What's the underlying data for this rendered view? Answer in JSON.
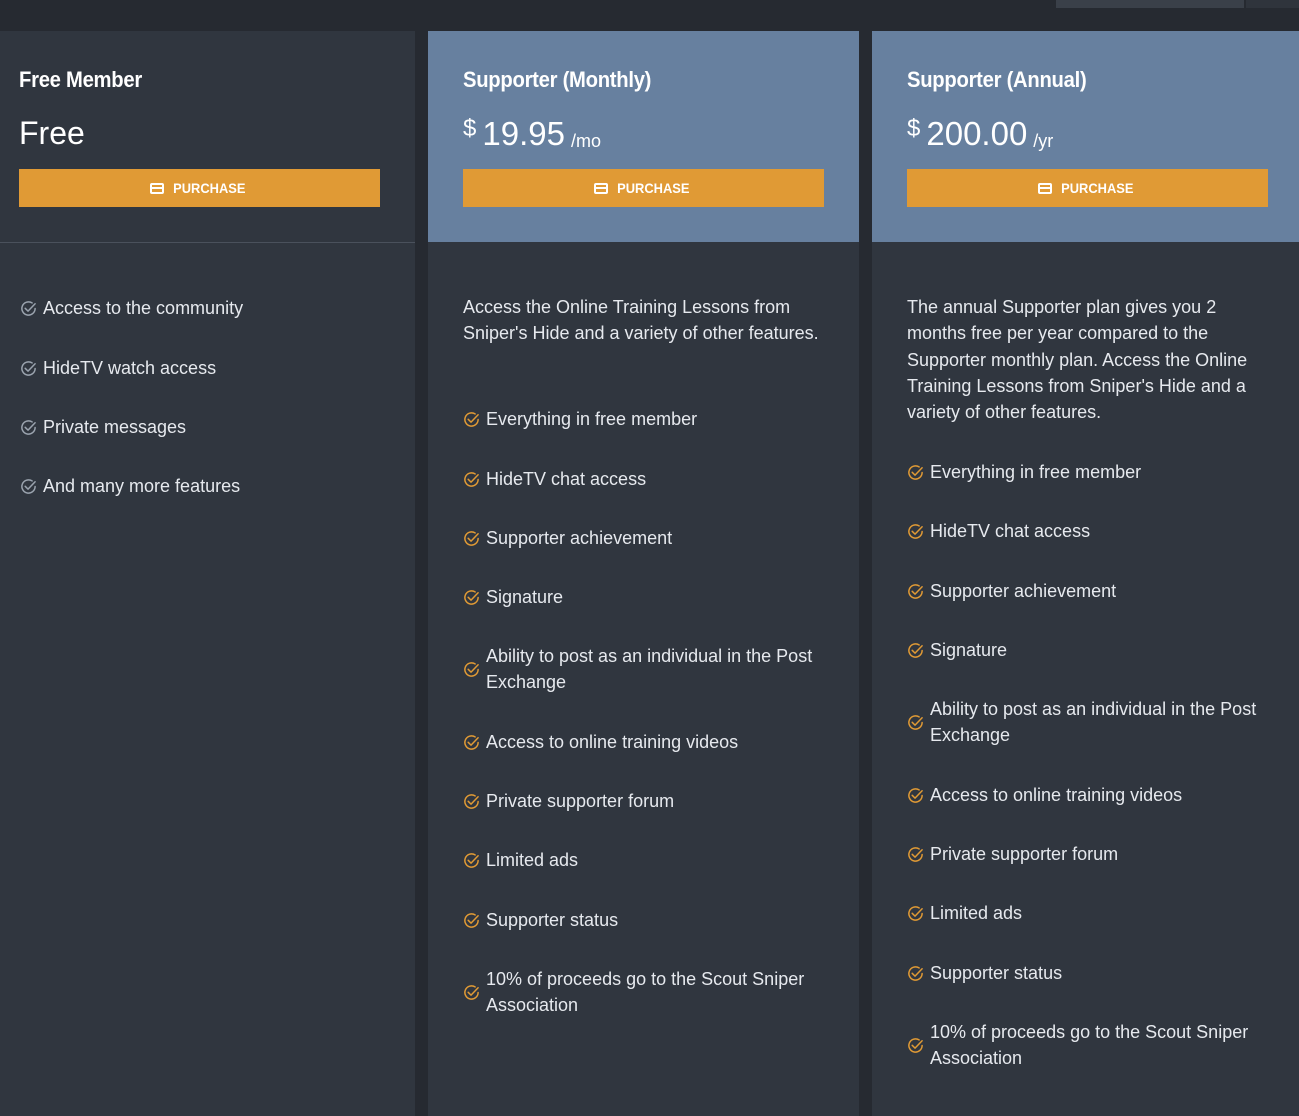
{
  "plans": [
    {
      "title": "Free Member",
      "price_text": "Free",
      "button_label": "PURCHASE",
      "features": [
        "Access to the community",
        "HideTV watch access",
        "Private messages",
        "And many more features"
      ]
    },
    {
      "title": "Supporter (Monthly)",
      "currency": "$",
      "amount": "19.95",
      "period": "/mo",
      "button_label": "PURCHASE",
      "description": "Access the Online Training Lessons from Sniper's Hide and a variety of other features.",
      "features": [
        "Everything in free member",
        "HideTV chat access",
        "Supporter achievement",
        "Signature",
        "Ability to post as an individual in the Post Exchange",
        "Access to online training videos",
        "Private supporter forum",
        "Limited ads",
        "Supporter status",
        "10% of proceeds go to the Scout Sniper Association"
      ]
    },
    {
      "title": "Supporter (Annual)",
      "currency": "$",
      "amount": "200.00",
      "period": "/yr",
      "button_label": "PURCHASE",
      "description": "The annual Supporter plan gives you 2 months free per year compared to the Supporter monthly plan. Access the Online Training Lessons from Sniper's Hide and a variety of other features.",
      "features": [
        "Everything in free member",
        "HideTV chat access",
        "Supporter achievement",
        "Signature",
        "Ability to post as an individual in the Post Exchange",
        "Access to online training videos",
        "Private supporter forum",
        "Limited ads",
        "Supporter status",
        "10% of proceeds go to the Scout Sniper Association"
      ]
    }
  ],
  "icons": {
    "button": "credit-card-icon",
    "feature": "check-circle-icon"
  },
  "colors": {
    "accent": "#e09a35",
    "highlight_header": "#67809f",
    "panel": "#30363f",
    "page": "#262a31",
    "check_free": "#9aa3ae",
    "check_paid": "#e09a35"
  }
}
